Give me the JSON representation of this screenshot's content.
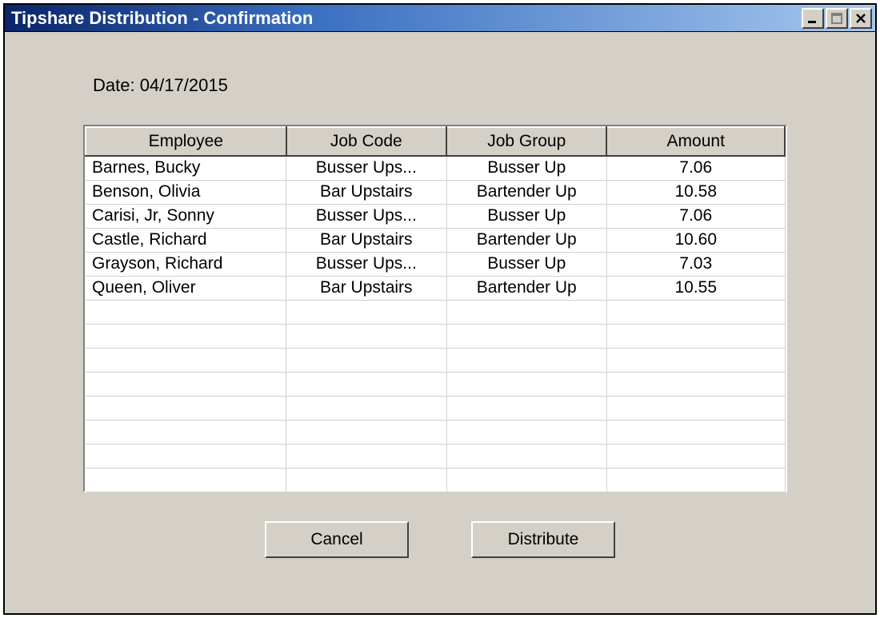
{
  "window": {
    "title": "Tipshare Distribution - Confirmation",
    "date_label": "Date: 04/17/2015"
  },
  "table": {
    "headers": {
      "employee": "Employee",
      "job_code": "Job Code",
      "job_group": "Job Group",
      "amount": "Amount"
    },
    "rows": [
      {
        "employee": "Barnes, Bucky",
        "job_code": "Busser Ups...",
        "job_group": "Busser Up",
        "amount": "7.06"
      },
      {
        "employee": "Benson, Olivia",
        "job_code": "Bar Upstairs",
        "job_group": "Bartender Up",
        "amount": "10.58"
      },
      {
        "employee": "Carisi, Jr, Sonny",
        "job_code": "Busser Ups...",
        "job_group": "Busser Up",
        "amount": "7.06"
      },
      {
        "employee": "Castle, Richard",
        "job_code": "Bar Upstairs",
        "job_group": "Bartender Up",
        "amount": "10.60"
      },
      {
        "employee": "Grayson, Richard",
        "job_code": "Busser Ups...",
        "job_group": "Busser Up",
        "amount": "7.03"
      },
      {
        "employee": "Queen, Oliver",
        "job_code": "Bar Upstairs",
        "job_group": "Bartender Up",
        "amount": "10.55"
      }
    ],
    "blank_rows": 8
  },
  "buttons": {
    "cancel": "Cancel",
    "distribute": "Distribute"
  }
}
